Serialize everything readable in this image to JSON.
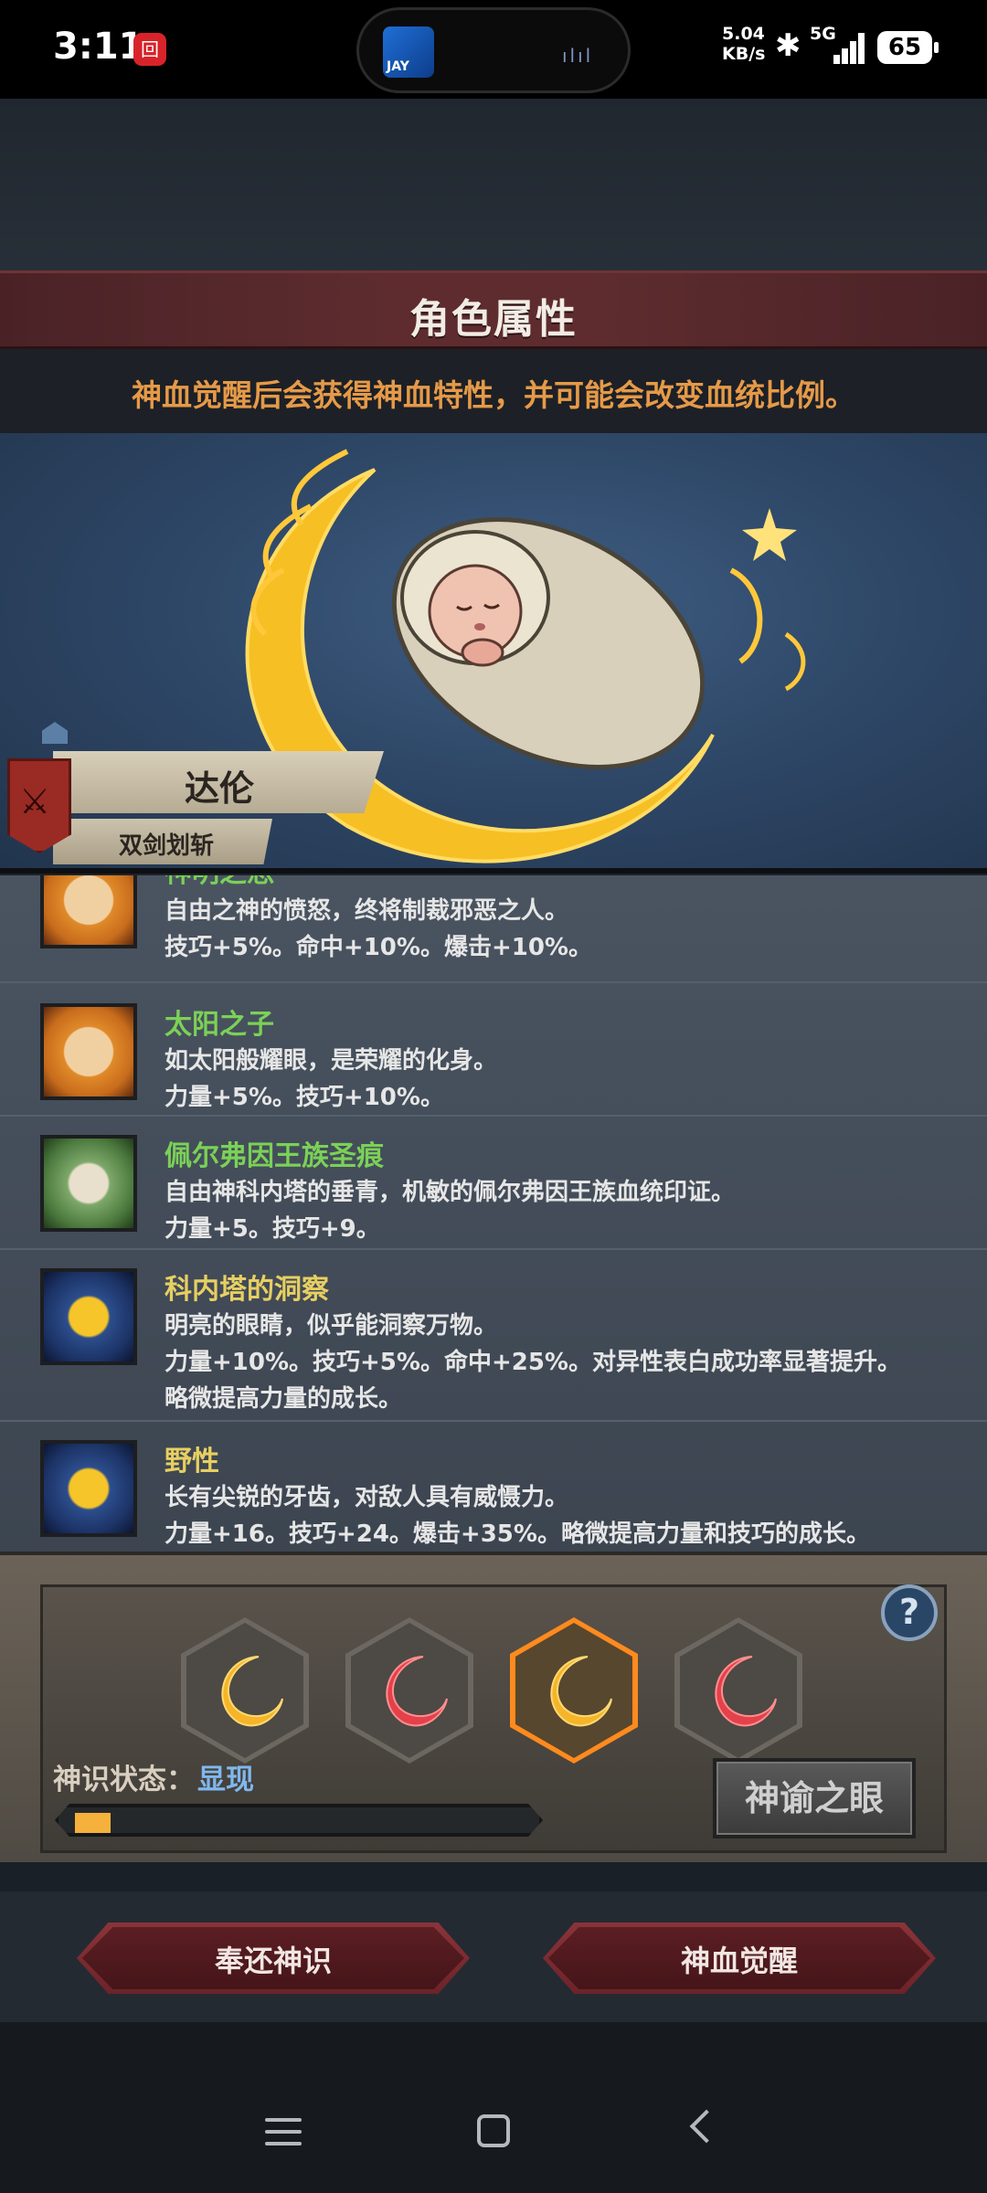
{
  "status_bar": {
    "time": "3:11",
    "notification_badge": "回",
    "island_app_label": "JAY",
    "net_speed_value": "5.04",
    "net_speed_unit": "KB/s",
    "network": "5G",
    "battery": "65"
  },
  "header": {
    "title": "角色属性",
    "subtitle": "神血觉醒后会获得神血特性，并可能会改变血统比例。"
  },
  "character": {
    "name": "达伦",
    "skill": "双剑划斩"
  },
  "traits": [
    {
      "name": "神明之怒",
      "name_color": "green",
      "icon": "sun-face-icon",
      "desc": "自由之神的愤怒，终将制裁邪恶之人。",
      "effect": "技巧+5%。命中+10%。爆击+10%。",
      "extra": ""
    },
    {
      "name": "太阳之子",
      "name_color": "green",
      "icon": "sun-face-icon",
      "desc": "如太阳般耀眼，是荣耀的化身。",
      "effect": "力量+5%。技巧+10%。",
      "extra": ""
    },
    {
      "name": "佩尔弗因王族圣痕",
      "name_color": "green",
      "icon": "white-crescent-icon",
      "desc": "自由神科内塔的垂青，机敏的佩尔弗因王族血统印证。",
      "effect": "力量+5。技巧+9。",
      "extra": ""
    },
    {
      "name": "科内塔的洞察",
      "name_color": "gold",
      "icon": "gold-crescent-icon",
      "desc": "明亮的眼睛，似乎能洞察万物。",
      "effect": "力量+10%。技巧+5%。命中+25%。对异性表白成功率显著提升。",
      "extra": "略微提高力量的成长。"
    },
    {
      "name": "野性",
      "name_color": "gold",
      "icon": "gold-crescent-icon",
      "desc": "长有尖锐的牙齿，对敌人具有威慑力。",
      "effect": "力量+16。技巧+24。爆击+35%。略微提高力量和技巧的成长。",
      "extra": ""
    }
  ],
  "panel": {
    "help_label": "?",
    "state_label": "神识状态：",
    "state_value": "显现",
    "progress": 0.08,
    "oracle_button": "神谕之眼",
    "slots": [
      {
        "icon": "gold-crescent-icon",
        "selected": false
      },
      {
        "icon": "red-crescent-icon",
        "selected": false
      },
      {
        "icon": "gold-crescent-icon",
        "selected": true
      },
      {
        "icon": "red-crescent-icon",
        "selected": false
      }
    ]
  },
  "actions": {
    "return_button": "奉还神识",
    "awaken_button": "神血觉醒"
  },
  "colors": {
    "accent_orange": "#e59a48",
    "trait_green": "#7bd157",
    "trait_gold": "#e7cf62",
    "state_blue": "#7fb8ee",
    "selected_slot": "#ff8a1e"
  }
}
